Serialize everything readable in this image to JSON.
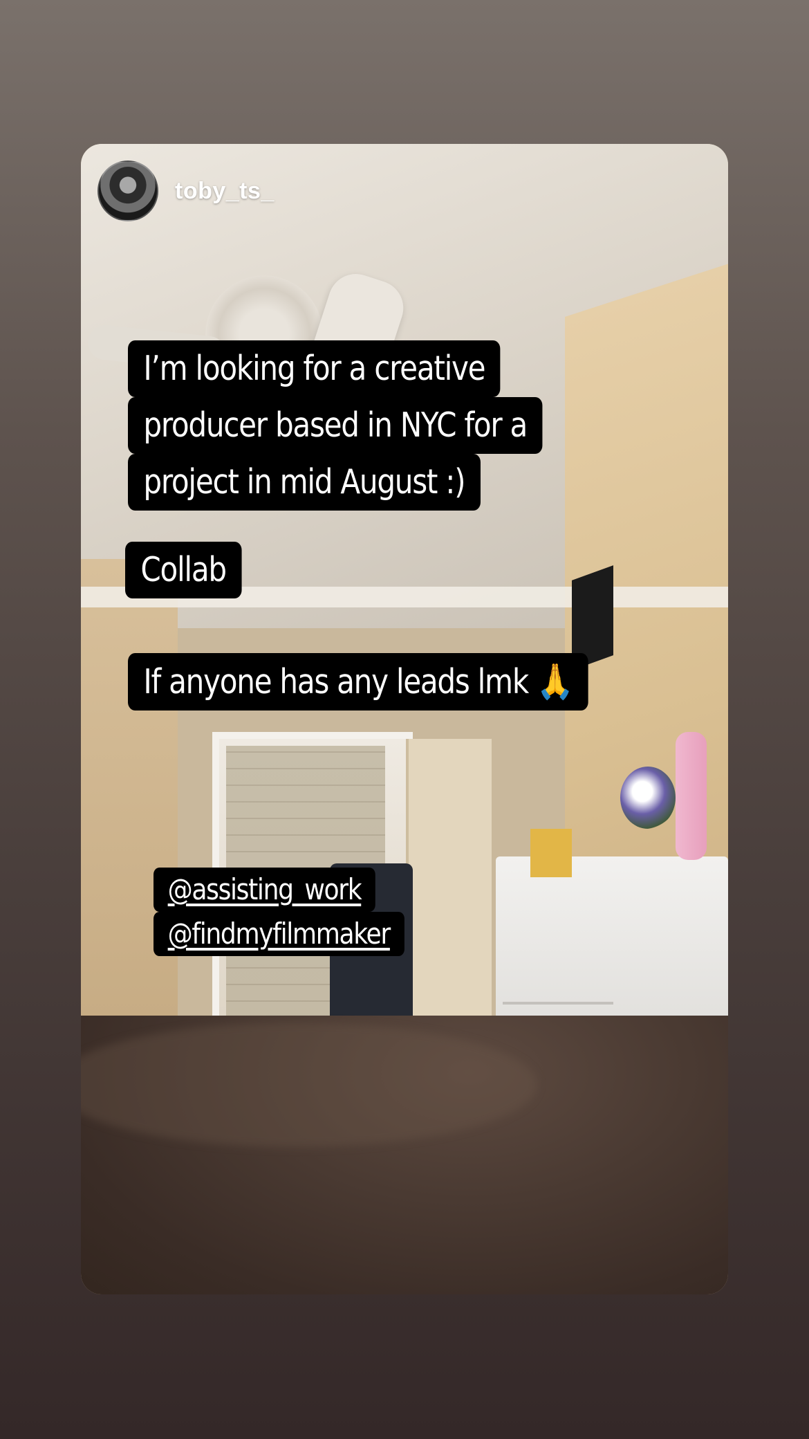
{
  "story": {
    "username": "toby_ts_",
    "captions": [
      "I’m looking for a creative",
      "producer based in NYC for a",
      "project in mid August :)"
    ],
    "collab": "Collab",
    "leads_text": "If anyone has any leads lmk",
    "leads_emoji": "🙏",
    "mentions": [
      "@assisting_work",
      "@findmyfilmmaker"
    ]
  },
  "colors": {
    "caption_bg": "#000000",
    "caption_text": "#ffffff"
  },
  "icons": {
    "avatar": "profile-avatar"
  }
}
